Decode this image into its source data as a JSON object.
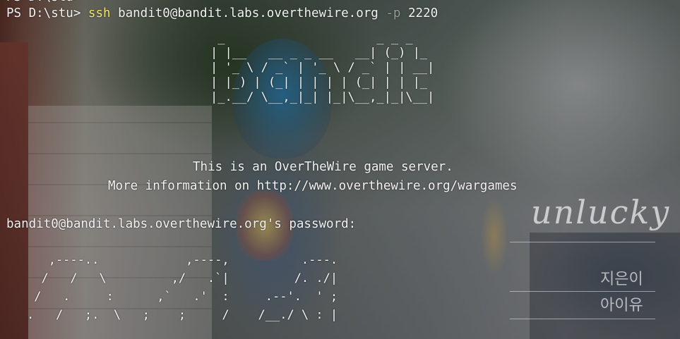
{
  "terminal": {
    "top_partial": "PS D:\\stu>",
    "command_prompt": {
      "prefix": "PS D:\\stu>",
      "command": "ssh",
      "target": "bandit0@bandit.labs.overthewire.org",
      "flag": "-p",
      "port": "2220"
    },
    "banner_ascii": " _                     _ _ _   \n| |__   __ _ _ __   __| (_) |_ \n| '_ \\ / _` | '_ \\ / _` | | __|\n| |_) | (_| | | | | (_| | | |_ \n|_.__/ \\__,_|_| |_|\\__,_|_|\\__|",
    "welcome_line": "This is an OverTheWire game server.",
    "info_line": "More information on http://www.overthewire.org/wargames",
    "password_prompt": "bandit0@bandit.labs.overthewire.org's password:",
    "bottom_ascii": "   ,----..            ,----,          .---.\n  /   /   \\         ,/   .`|         /. ./|\n /   .     :      ,`   .'  :     .--'.  ' ;\n.   /   ;.  \\   ;    ;     /    /__./ \\ : |"
  },
  "wallpaper": {
    "title": "unlucky",
    "artist_korean": "지은이",
    "artist_name": "아이유"
  }
}
